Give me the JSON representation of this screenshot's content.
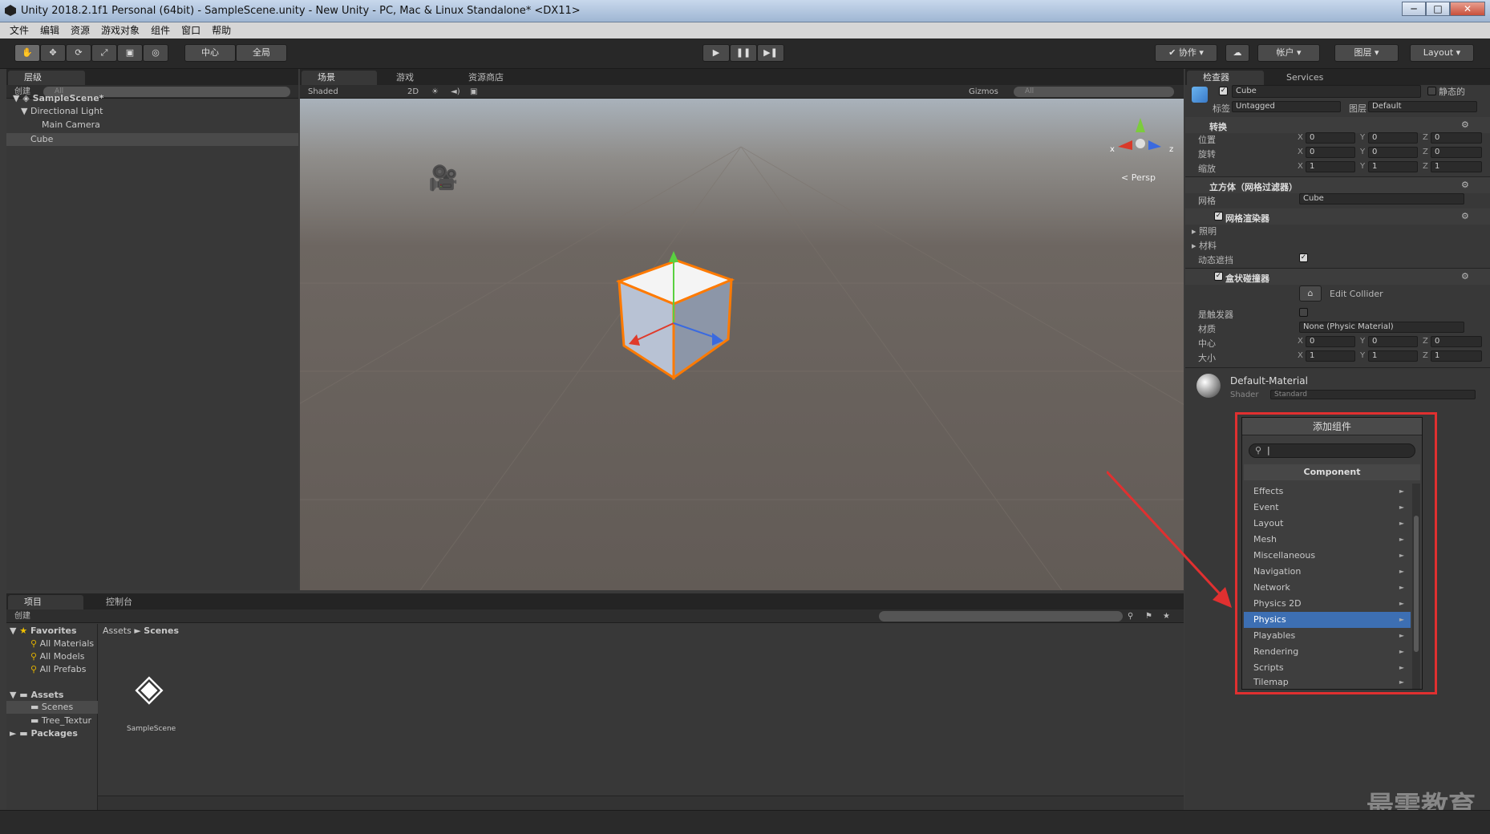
{
  "window": {
    "title": "Unity 2018.2.1f1 Personal (64bit) - SampleScene.unity - New Unity - PC, Mac & Linux Standalone* <DX11>",
    "minimize": "─",
    "maximize": "□",
    "close": "✕"
  },
  "menu": [
    "文件",
    "编辑",
    "资源",
    "游戏对象",
    "组件",
    "窗口",
    "帮助"
  ],
  "toolbar": {
    "pivot": "中心",
    "global": "全局",
    "collab": "协作",
    "account": "帐户",
    "layers": "图层",
    "layout": "Layout"
  },
  "hierarchy": {
    "tab": "层级",
    "create": "创建",
    "search": "All",
    "scene": "SampleScene*",
    "items": [
      "Directional Light",
      "Main Camera",
      "Cube"
    ]
  },
  "scene": {
    "tabs": [
      "场景",
      "游戏",
      "资源商店"
    ],
    "shading": "Shaded",
    "mode2d": "2D",
    "gizmos": "Gizmos",
    "search": "All",
    "persp": "< Persp",
    "gizmo_axes": {
      "x": "x",
      "z": "z"
    }
  },
  "inspector": {
    "tabs": [
      "检查器",
      "Services"
    ],
    "object_name": "Cube",
    "static_label": "静态的",
    "tag_label": "标签",
    "tag_value": "Untagged",
    "layer_label": "图层",
    "layer_value": "Default",
    "transform": {
      "title": "转换",
      "rows": [
        {
          "label": "位置",
          "x": "0",
          "y": "0",
          "z": "0"
        },
        {
          "label": "旋转",
          "x": "0",
          "y": "0",
          "z": "0"
        },
        {
          "label": "缩放",
          "x": "1",
          "y": "1",
          "z": "1"
        }
      ]
    },
    "mesh_filter": {
      "title": "立方体（网格过滤器）",
      "mesh_label": "网格",
      "mesh_value": "Cube"
    },
    "mesh_renderer": {
      "title": "网格渲染器",
      "lighting": "照明",
      "materials": "材料",
      "dynamic_occlusion": "动态遮挡"
    },
    "box_collider": {
      "title": "盒状碰撞器",
      "edit": "Edit Collider",
      "is_trigger": "是触发器",
      "material_label": "材质",
      "material_value": "None (Physic Material)",
      "center_label": "中心",
      "center": {
        "x": "0",
        "y": "0",
        "z": "0"
      },
      "size_label": "大小",
      "size": {
        "x": "1",
        "y": "1",
        "z": "1"
      }
    },
    "material": {
      "name": "Default-Material",
      "shader_label": "Shader",
      "shader_value": "Standard"
    },
    "axis": {
      "x": "X",
      "y": "Y",
      "z": "Z"
    }
  },
  "add_component": {
    "title": "添加组件",
    "search_value": "|",
    "section": "Component",
    "items": [
      "Effects",
      "Event",
      "Layout",
      "Mesh",
      "Miscellaneous",
      "Navigation",
      "Network",
      "Physics 2D",
      "Physics",
      "Playables",
      "Rendering",
      "Scripts",
      "Tilemap"
    ],
    "selected": "Physics"
  },
  "project": {
    "tabs": [
      "项目",
      "控制台"
    ],
    "create": "创建",
    "favorites": "Favorites",
    "fav_items": [
      "All Materials",
      "All Models",
      "All Prefabs"
    ],
    "assets": "Assets",
    "asset_items": [
      "Scenes",
      "Tree_Textur"
    ],
    "packages": "Packages",
    "breadcrumb": [
      "Assets",
      "Scenes"
    ],
    "breadcrumb_sep": "►",
    "file": "SampleScene"
  },
  "watermark": "最需教育",
  "colors": {
    "highlight": "#e03030",
    "selection": "#3d6fb3"
  }
}
